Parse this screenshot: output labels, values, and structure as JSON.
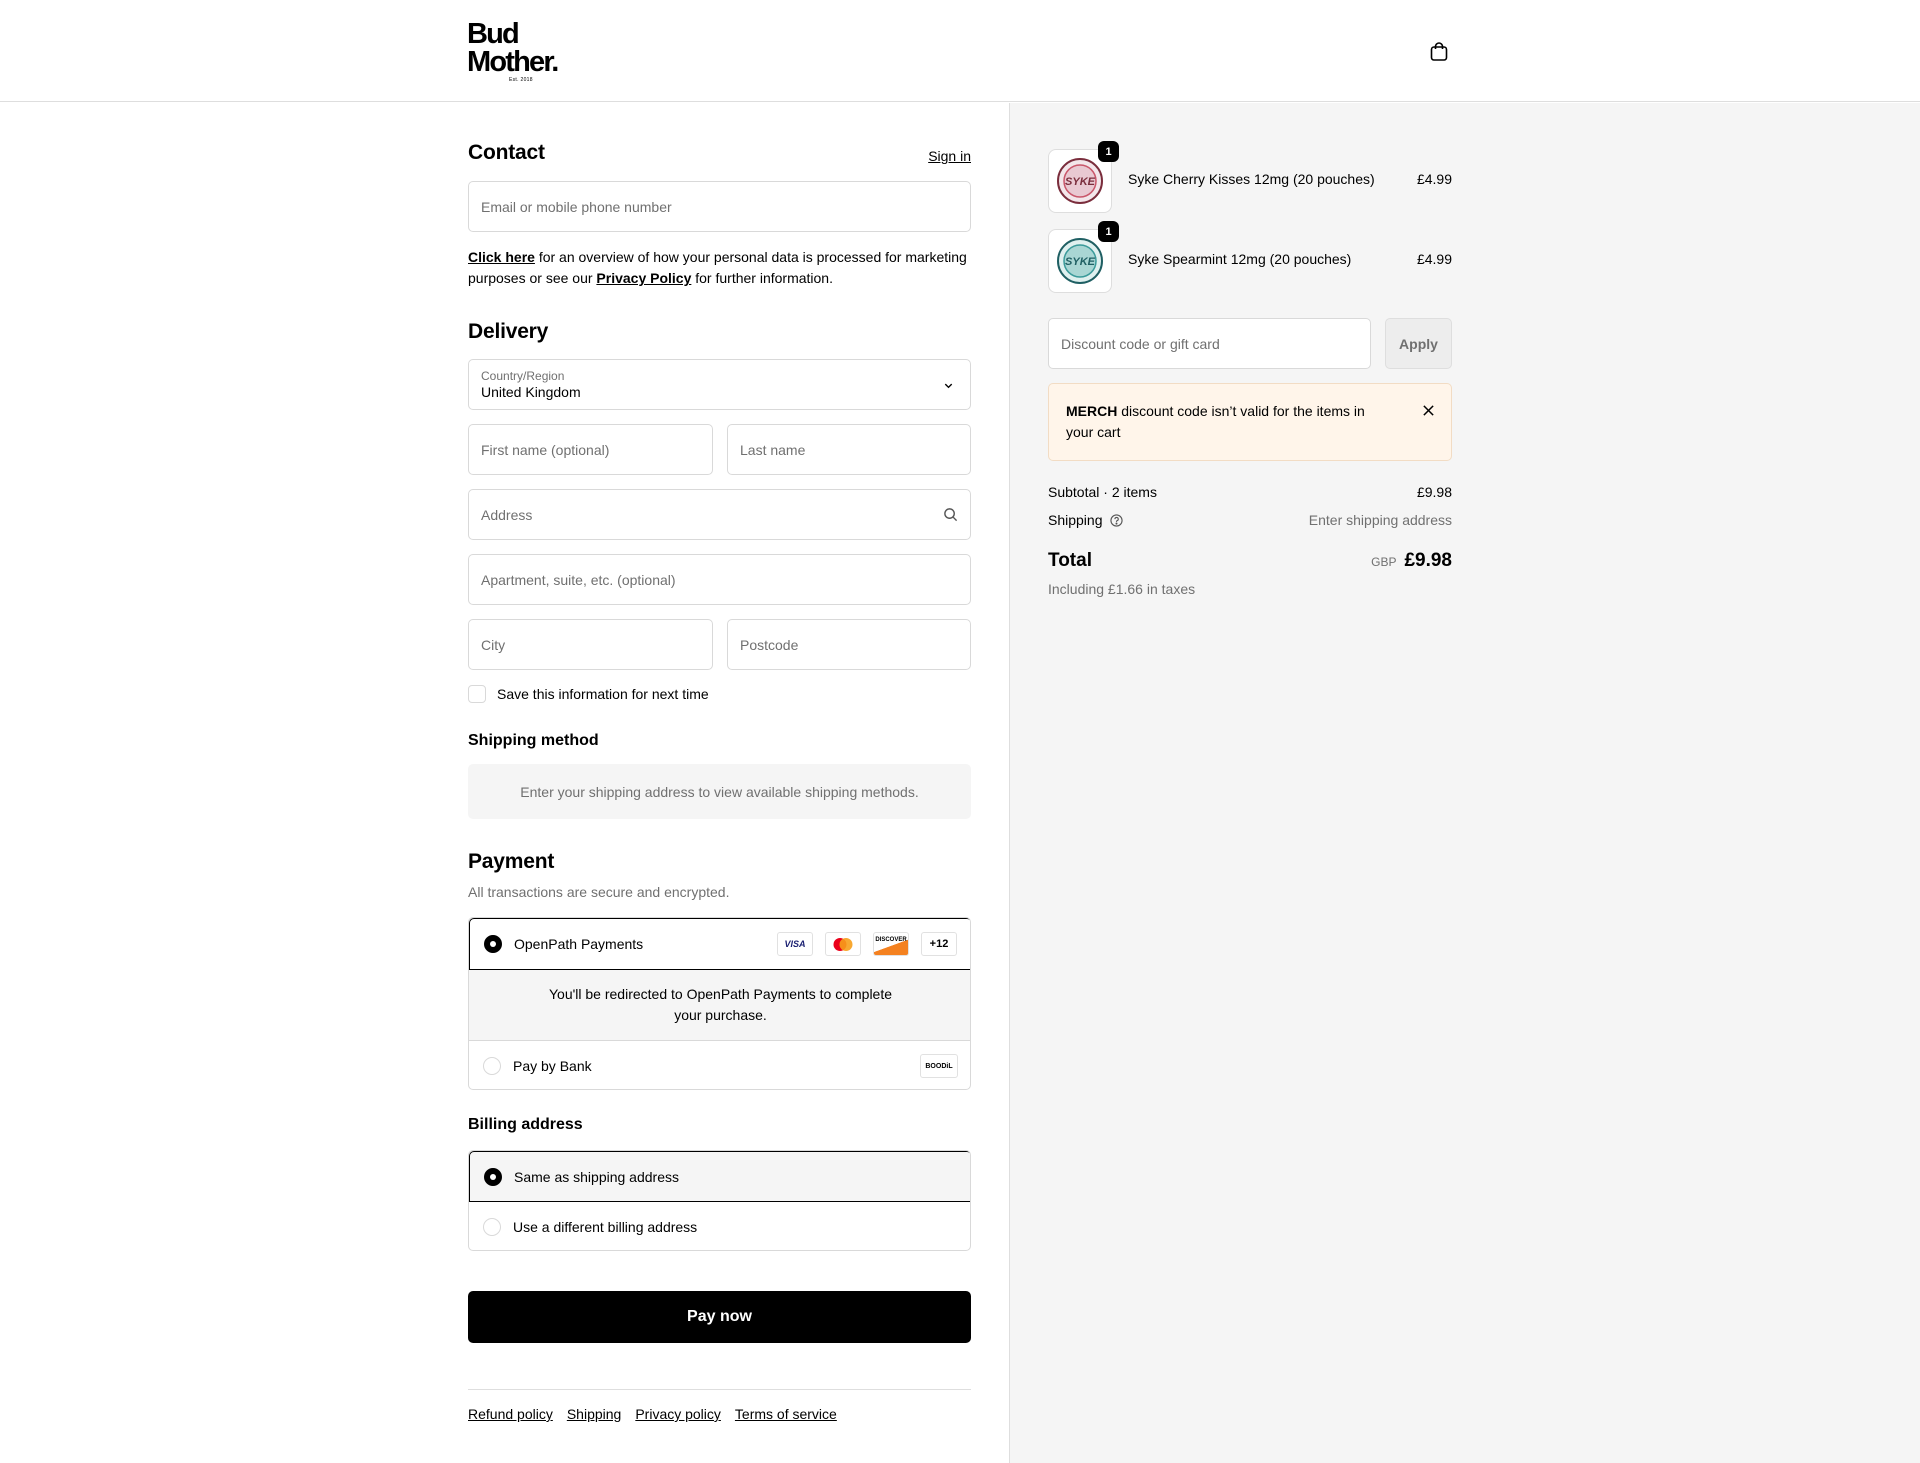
{
  "header": {
    "logo_line1": "Bud",
    "logo_line2": "Mother.",
    "logo_line3": "Est. 2018",
    "cart_icon": "shopping-bag-icon"
  },
  "contact": {
    "title": "Contact",
    "sign_in": "Sign in",
    "email_placeholder": "Email or mobile phone number",
    "privacy_click_here": "Click here",
    "privacy_text_1": " for an overview of how your personal data is processed for marketing purposes or see our ",
    "privacy_policy_link": "Privacy Policy",
    "privacy_text_2": " for further information."
  },
  "delivery": {
    "title": "Delivery",
    "country_label": "Country/Region",
    "country_value": "United Kingdom",
    "first_name_placeholder": "First name (optional)",
    "last_name_placeholder": "Last name",
    "address_placeholder": "Address",
    "apartment_placeholder": "Apartment, suite, etc. (optional)",
    "city_placeholder": "City",
    "postcode_placeholder": "Postcode",
    "save_info_label": "Save this information for next time"
  },
  "shipping_method": {
    "title": "Shipping method",
    "notice": "Enter your shipping address to view available shipping methods."
  },
  "payment": {
    "title": "Payment",
    "subtitle": "All transactions are secure and encrypted.",
    "option1_label": "OpenPath Payments",
    "card_visa": "VISA",
    "card_discover": "DISCOVER",
    "card_more": "+12",
    "redirect_line1": "You'll be redirected to OpenPath Payments to complete",
    "redirect_line2": "your purchase.",
    "option2_label": "Pay by Bank",
    "bank_logo": "BOODiL"
  },
  "billing": {
    "title": "Billing address",
    "same_label": "Same as shipping address",
    "different_label": "Use a different billing address"
  },
  "pay_now": "Pay now",
  "footer": {
    "refund": "Refund policy",
    "shipping": "Shipping",
    "privacy": "Privacy policy",
    "terms": "Terms of service"
  },
  "summary": {
    "items": [
      {
        "name": "Syke Cherry Kisses 12mg (20 pouches)",
        "price": "£4.99",
        "qty": "1",
        "thumb_text": "SYKE",
        "thumb_color": "#c9566a"
      },
      {
        "name": "Syke Spearmint 12mg (20 pouches)",
        "price": "£4.99",
        "qty": "1",
        "thumb_text": "SYKE",
        "thumb_color": "#3a9a9a"
      }
    ],
    "discount_placeholder": "Discount code or gift card",
    "apply_label": "Apply",
    "error_code": "MERCH",
    "error_text": " discount code isn’t valid for the items in your cart",
    "subtotal_label": "Subtotal · 2 items",
    "subtotal_value": "£9.98",
    "shipping_label": "Shipping",
    "shipping_value": "Enter shipping address",
    "total_label": "Total",
    "currency": "GBP",
    "total_value": "£9.98",
    "tax_note": "Including £1.66 in taxes"
  },
  "colors": {
    "error_bg": "#fff5ea",
    "error_border": "#f2dcc4",
    "summary_bg": "#f5f5f5"
  }
}
